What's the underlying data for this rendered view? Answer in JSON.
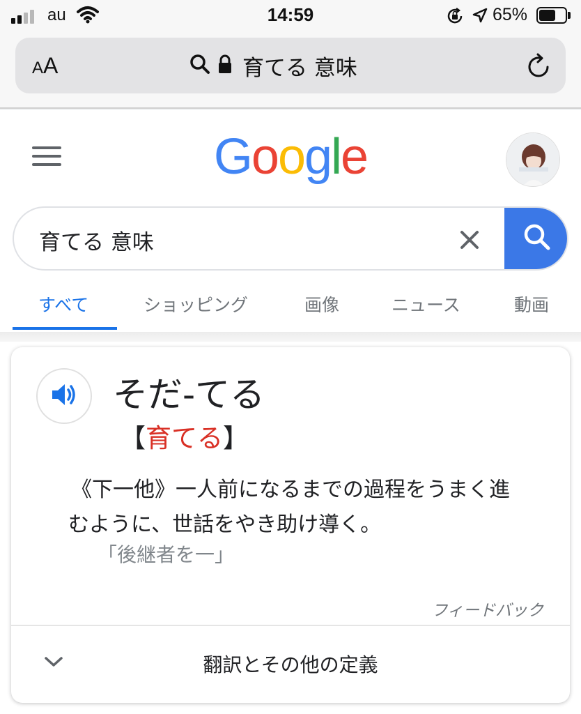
{
  "status_bar": {
    "carrier": "au",
    "time": "14:59",
    "battery_percent": "65%",
    "battery_level": 0.65,
    "icons": [
      "signal-icon",
      "wifi-icon",
      "rotation-lock-icon",
      "location-icon",
      "battery-icon"
    ]
  },
  "browser": {
    "text_size_small": "A",
    "text_size_large": "A",
    "url_text": "育てる 意味",
    "icons": [
      "search-icon",
      "lock-icon",
      "reload-icon"
    ]
  },
  "google": {
    "logo_letters": [
      "G",
      "o",
      "o",
      "g",
      "l",
      "e"
    ],
    "logo_colors": [
      "#4285F4",
      "#EA4335",
      "#FBBC05",
      "#4285F4",
      "#34A853",
      "#EA4335"
    ],
    "search_value": "育てる 意味",
    "tabs": [
      {
        "label": "すべて",
        "active": true
      },
      {
        "label": "ショッピング",
        "active": false
      },
      {
        "label": "画像",
        "active": false
      },
      {
        "label": "ニュース",
        "active": false
      },
      {
        "label": "動画",
        "active": false
      }
    ],
    "accent_color": "#1a73e8"
  },
  "dictionary": {
    "reading": "そだ-てる",
    "bracket_open": "【",
    "kanji": "育てる",
    "bracket_close": "】",
    "definition_line1": "《下一他》一人前になるまでの過程をうまく進",
    "definition_line2": "むように、世話をやき助け導く。",
    "example": "「後継者を一」",
    "feedback": "フィードバック",
    "more_label": "翻訳とその他の定義"
  }
}
